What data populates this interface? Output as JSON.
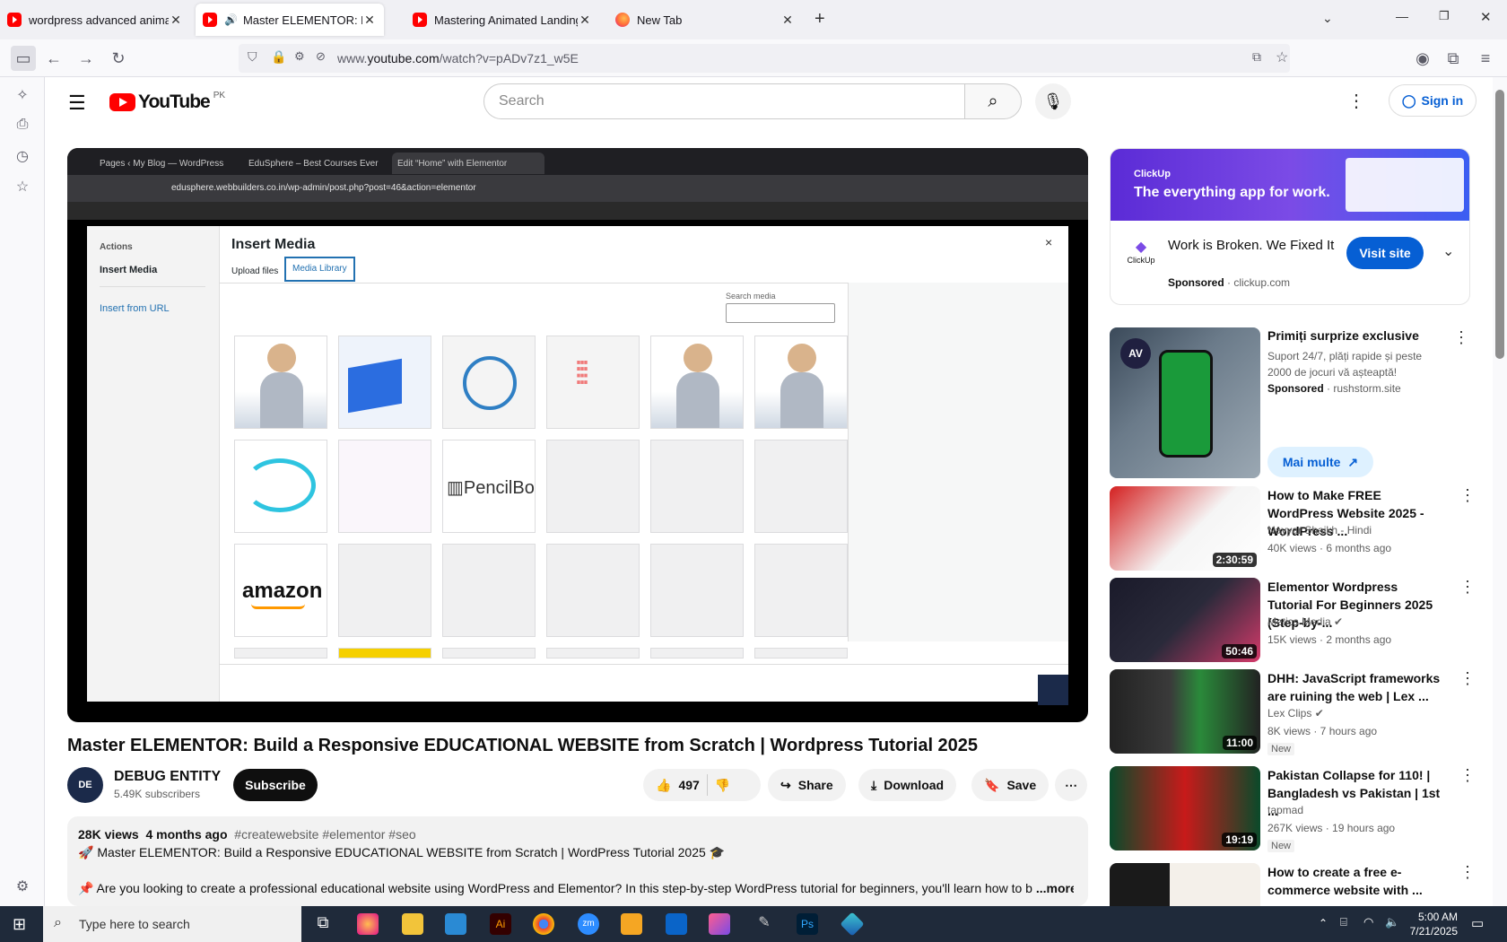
{
  "browser": {
    "tabs": [
      {
        "title": "wordpress advanced animation"
      },
      {
        "title": "Master ELEMENTOR: Build a"
      },
      {
        "title": "Mastering Animated Landing Pa"
      },
      {
        "title": "New Tab"
      }
    ],
    "url_prefix": "www.",
    "url_host": "youtube.com",
    "url_path": "/watch?v=pADv7z1_w5E"
  },
  "youtube": {
    "logo_text": "YouTube",
    "country_code": "PK",
    "search_placeholder": "Search",
    "signin_label": "Sign in"
  },
  "video": {
    "inner_tabs": [
      "Pages ‹ My Blog — WordPress",
      "EduSphere – Best Courses Ever",
      "Edit “Home” with Elementor"
    ],
    "inner_url": "edusphere.webbuilders.co.in/wp-admin/post.php?post=46&action=elementor",
    "modal": {
      "actions_heading": "Actions",
      "action_insert_media": "Insert Media",
      "action_insert_url": "Insert from URL",
      "title": "Insert Media",
      "tab_upload": "Upload files",
      "tab_library": "Media Library",
      "search_label": "Search media",
      "close": "×"
    },
    "title": "Master ELEMENTOR: Build a Responsive EDUCATIONAL WEBSITE from Scratch | Wordpress Tutorial 2025",
    "channel": {
      "name": "DEBUG ENTITY",
      "subscribers": "5.49K subscribers",
      "avatar_text": "DE"
    },
    "subscribe_label": "Subscribe",
    "likes": "497",
    "share_label": "Share",
    "download_label": "Download",
    "save_label": "Save",
    "views": "28K views",
    "age": "4 months ago",
    "tags": "#createwebsite #elementor #seo",
    "desc_line1": "🚀 Master ELEMENTOR: Build a Responsive EDUCATIONAL WEBSITE from Scratch | WordPress Tutorial 2025 🎓",
    "desc_line2": "📌 Are you looking to create a professional educational website using WordPress and Elementor? In this step-by-step WordPress tutorial for beginners, you'll learn how to b",
    "more_label": "...more"
  },
  "ad": {
    "banner_brand": "ClickUp",
    "banner_text": "The everything app for work.",
    "headline": "Work is Broken. We Fixed It",
    "sponsored": "Sponsored",
    "domain": "· clickup.com",
    "cta": "Visit site",
    "icon_text": "ClickUp"
  },
  "ad2": {
    "title": "Primiți surprize exclusive",
    "desc": "Suport 24/7, plăți rapide și peste 2000 de jocuri vă așteaptă!",
    "sponsored": "Sponsored",
    "domain": "· rushstorm.site",
    "cta": "Mai multe",
    "logo_text": "AV"
  },
  "recs": [
    {
      "title": "How to Make FREE WordPress Website 2025 - WordPress ...",
      "channel": "Nayyar Shaikh - Hindi",
      "meta": "40K views · 6 months ago",
      "duration": "2:30:59",
      "new": ""
    },
    {
      "title": "Elementor Wordpress Tutorial For Beginners 2025 (Step-by-...",
      "channel": "Metics Media ✔",
      "meta": "15K views · 2 months ago",
      "duration": "50:46",
      "new": ""
    },
    {
      "title": "DHH: JavaScript frameworks are ruining the web | Lex ...",
      "channel": "Lex Clips ✔",
      "meta": "8K views · 7 hours ago",
      "duration": "11:00",
      "new": "New"
    },
    {
      "title": "Pakistan Collapse for 110! | Bangladesh vs Pakistan | 1st ...",
      "channel": "tapmad",
      "meta": "267K views · 19 hours ago",
      "duration": "19:19",
      "new": "New"
    },
    {
      "title": "How to create a free e-commerce website with ...",
      "channel": "",
      "meta": "",
      "duration": "",
      "new": ""
    }
  ],
  "taskbar": {
    "search_placeholder": "Type here to search",
    "time": "5:00 AM",
    "date": "7/21/2025"
  },
  "colors": {
    "brand_red": "#ff0000",
    "link_blue": "#065fd4",
    "taskbar": "#1f2a3a"
  }
}
